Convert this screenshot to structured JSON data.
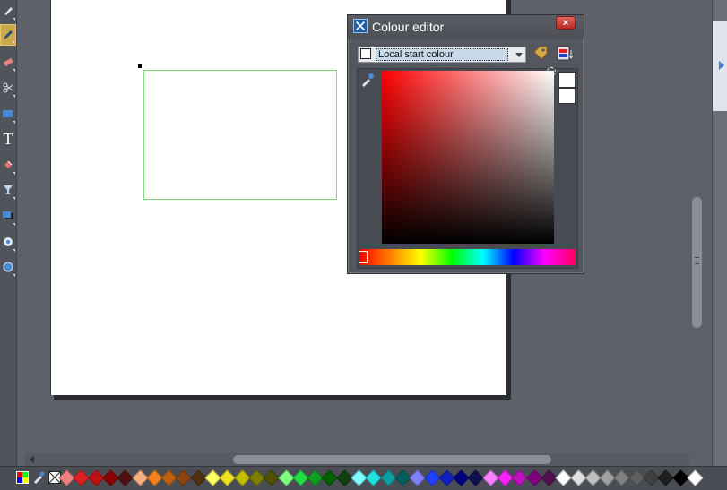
{
  "dialog": {
    "title": "Colour editor",
    "close_label": "×",
    "colour_target": "Local start colour",
    "colour_hex": "#ffffff"
  },
  "editor": {
    "hue": "red",
    "current_colour": "#ffffff",
    "previous_colour": "#ffffff"
  },
  "toolbar": {
    "tools": [
      {
        "name": "selector-tool",
        "icon": "arrow-icon"
      },
      {
        "name": "freehand-tool",
        "icon": "pen-icon",
        "active": true
      },
      {
        "name": "eraser-tool",
        "icon": "eraser-icon"
      },
      {
        "name": "contour-tool",
        "icon": "scissors-icon"
      },
      {
        "name": "rectangle-tool",
        "icon": "rectangle-icon"
      },
      {
        "name": "text-tool",
        "icon": "text-icon",
        "glyph": "T"
      },
      {
        "name": "fill-tool",
        "icon": "fill-icon"
      },
      {
        "name": "transparency-tool",
        "icon": "glass-icon"
      },
      {
        "name": "shadow-tool",
        "icon": "shadow-icon"
      },
      {
        "name": "bevel-tool",
        "icon": "bevel-icon"
      },
      {
        "name": "mould-tool",
        "icon": "mould-icon"
      }
    ]
  },
  "palette": {
    "colours": [
      "#f08080",
      "#e02020",
      "#c01010",
      "#8b0000",
      "#501010",
      "#f4b080",
      "#f08020",
      "#c06010",
      "#8b4513",
      "#503010",
      "#ffff60",
      "#f0e020",
      "#c0c000",
      "#808000",
      "#505000",
      "#80ff80",
      "#20e040",
      "#10a020",
      "#006000",
      "#104010",
      "#80ffff",
      "#20e0e0",
      "#10a0a0",
      "#006060",
      "#8080ff",
      "#2040ff",
      "#1020c0",
      "#000080",
      "#101050",
      "#ff80ff",
      "#ff20ff",
      "#c010c0",
      "#800080",
      "#501050",
      "#ffffff",
      "#e0e0e0",
      "#c0c0c0",
      "#a0a0a0",
      "#808080",
      "#606060",
      "#404040",
      "#202020",
      "#000000",
      "#ffffff"
    ]
  }
}
